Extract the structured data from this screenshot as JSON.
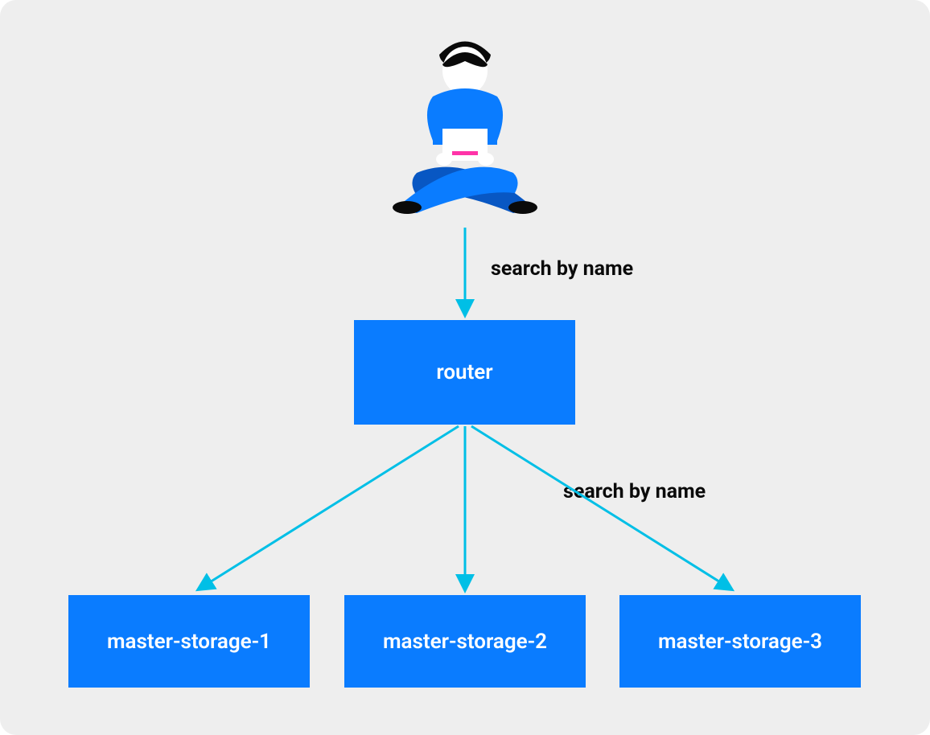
{
  "diagram": {
    "nodes": {
      "router": "router",
      "storage1": "master-storage-1",
      "storage2": "master-storage-2",
      "storage3": "master-storage-3"
    },
    "labels": {
      "arrow1": "search by name",
      "arrow2": "search by name"
    },
    "colors": {
      "box": "#0a7cff",
      "box_text": "#ffffff",
      "arrow": "#00bfe6",
      "label_text": "#0a0a0a",
      "bg": "#eeeeee",
      "hair": "#0a0a0a",
      "face": "#ffffff",
      "laptop_accent": "#ff33a8"
    }
  }
}
